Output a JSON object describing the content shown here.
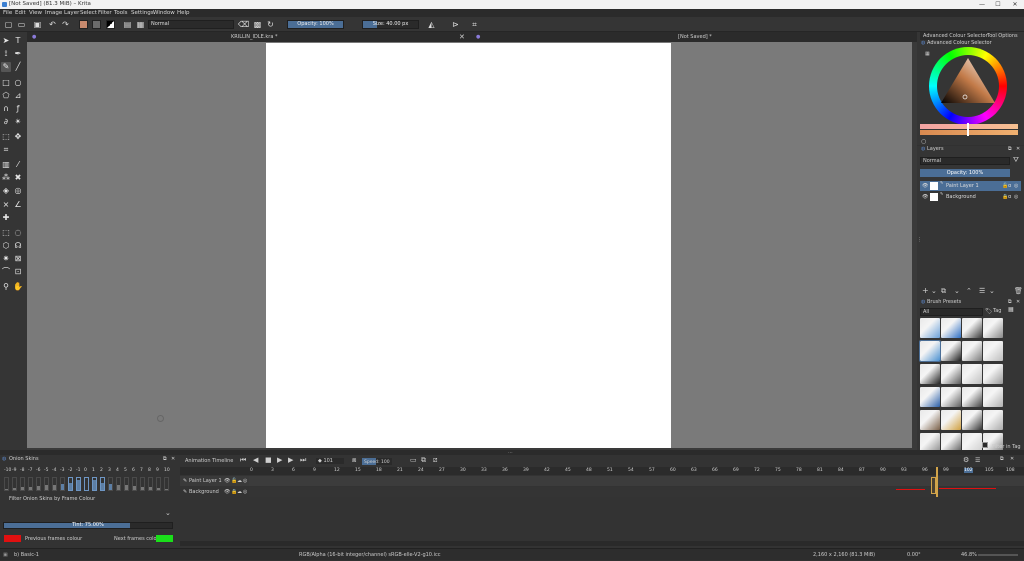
{
  "window": {
    "title": "[Not Saved]  (81.3 MiB)  – Krita",
    "controls": [
      "—",
      "☐",
      "✕"
    ]
  },
  "menu": [
    "File",
    "Edit",
    "View",
    "Image",
    "Layer",
    "Select",
    "Filter",
    "Tools",
    "Settings",
    "Window",
    "Help"
  ],
  "toolbar": {
    "blend_mode": "Normal",
    "opacity_label": "Opacity: 100%",
    "opacity_value": 1.0,
    "size_label": "Size: 40.00 px",
    "size_value": 0.25
  },
  "tabs": {
    "doc1": "KRILLIN_IDLE.kra *",
    "doc2": "[Not Saved] *"
  },
  "right_panel": {
    "tab_colour": "Advanced Colour Selector",
    "tab_tool": "Tool Options",
    "colour_title": "Advanced Colour Selector",
    "layers_title": "Layers",
    "layers_blend": "Normal",
    "layers_opacity": "Opacity: 100%",
    "layers": [
      {
        "name": "Paint Layer 1",
        "selected": true
      },
      {
        "name": "Background",
        "selected": false
      }
    ],
    "brush_title": "Brush Presets",
    "brush_filter": "All",
    "brush_tag": "Tag",
    "filter_tag": "Filter in Tag"
  },
  "onion": {
    "title": "Onion Skins",
    "numbers": [
      "-10",
      "-9",
      "-8",
      "-7",
      "-6",
      "-5",
      "-4",
      "-3",
      "-2",
      "-1",
      "0",
      "1",
      "2",
      "3",
      "4",
      "5",
      "6",
      "7",
      "8",
      "9",
      "10"
    ],
    "levels": [
      0.15,
      0.2,
      0.25,
      0.3,
      0.35,
      0.4,
      0.45,
      0.5,
      0.6,
      0.75,
      0,
      0.75,
      0.6,
      0.5,
      0.45,
      0.4,
      0.35,
      0.3,
      0.25,
      0.2,
      0.15
    ],
    "filter_label": "Filter Onion Skins by Frame Colour",
    "tint_label": "Tint: 75.00%",
    "tint_value": 0.75,
    "prev_label": "Previous frames colour",
    "next_label": "Next frames colour",
    "prev_color": "#e01010",
    "next_color": "#1adf1a"
  },
  "timeline": {
    "title": "Animation Timeline",
    "frame": "101",
    "speed_label": "Speed: 100 %",
    "frames": [
      "0",
      "3",
      "6",
      "9",
      "12",
      "15",
      "18",
      "21",
      "24",
      "27",
      "30",
      "33",
      "36",
      "39",
      "42",
      "45",
      "48",
      "51",
      "54",
      "57",
      "60",
      "63",
      "66",
      "69",
      "72",
      "75",
      "78",
      "81",
      "84",
      "87",
      "90",
      "93",
      "96",
      "99",
      "102",
      "105",
      "108",
      "111"
    ],
    "layers": [
      "Paint Layer 1",
      "Background"
    ]
  },
  "status": {
    "brush": "b) Basic-1",
    "colorspace": "RGB/Alpha (16-bit integer/channel)  sRGB-elle-V2-g10.icc",
    "dimensions": "2,160 x 2,160 (81.3 MiB)",
    "rotation": "0.00°",
    "zoom": "46.8%"
  }
}
